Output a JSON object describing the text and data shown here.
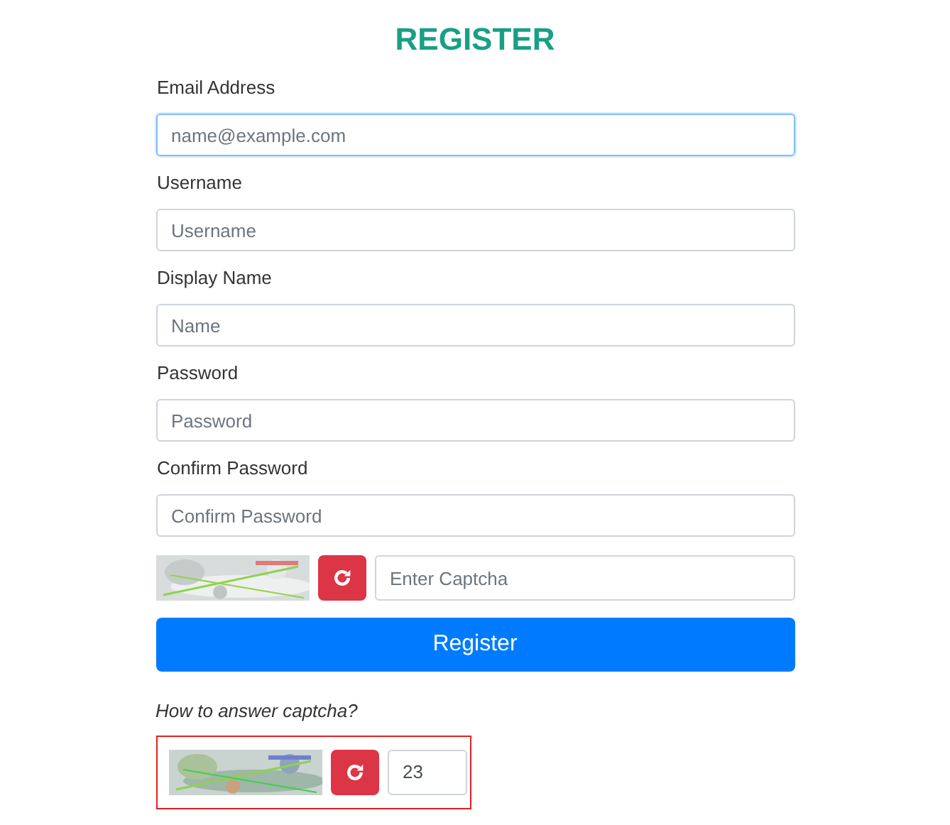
{
  "title": "REGISTER",
  "fields": [
    {
      "label": "Email Address",
      "placeholder": "name@example.com",
      "focused": true
    },
    {
      "label": "Username",
      "placeholder": "Username",
      "focused": false
    },
    {
      "label": "Display Name",
      "placeholder": "Name",
      "focused": false
    },
    {
      "label": "Password",
      "placeholder": "Password",
      "focused": false
    },
    {
      "label": "Confirm Password",
      "placeholder": "Confirm Password",
      "focused": false
    }
  ],
  "captcha": {
    "placeholder": "Enter Captcha"
  },
  "submit": "Register",
  "help": {
    "text": "How to answer captcha?",
    "example_value": "23"
  }
}
